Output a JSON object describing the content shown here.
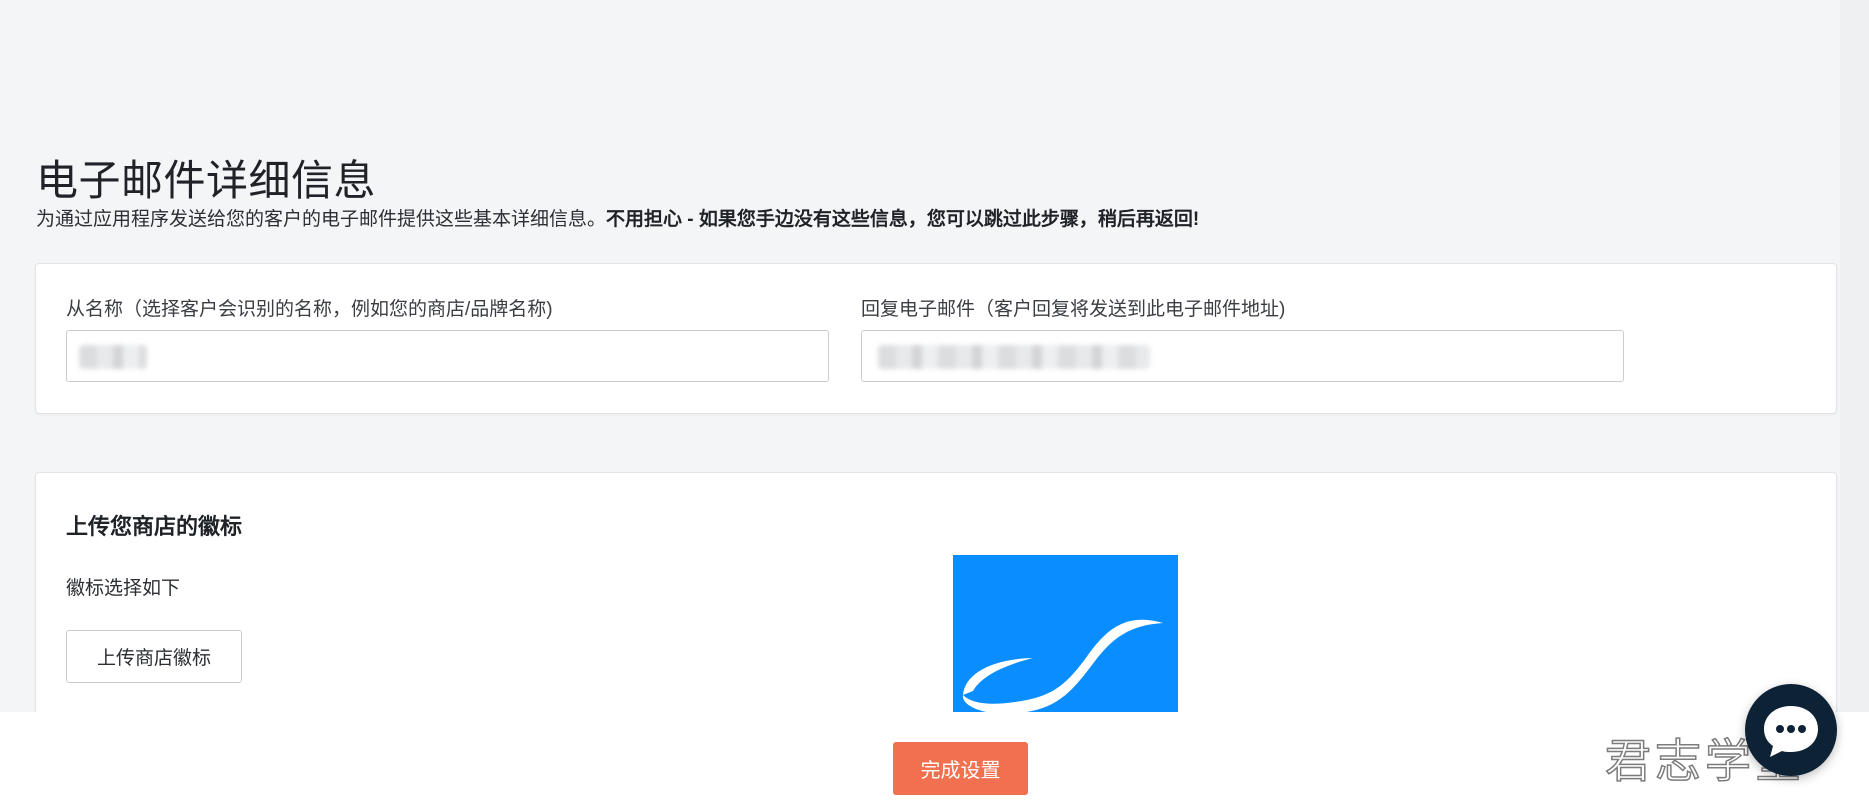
{
  "header": {
    "title": "电子邮件详细信息",
    "subtitle_normal": "为通过应用程序发送给您的客户的电子邮件提供这些基本详细信息。",
    "subtitle_bold": "不用担心 - 如果您手边没有这些信息，您可以跳过此步骤，稍后再返回!"
  },
  "email_card": {
    "from_name_label": "从名称（选择客户会识别的名称，例如您的商店/品牌名称)",
    "reply_email_label": "回复电子邮件（客户回复将发送到此电子邮件地址)"
  },
  "logo_card": {
    "heading": "上传您商店的徽标",
    "subheading": "徽标选择如下",
    "upload_button": "上传商店徽标"
  },
  "footer": {
    "finish_button": "完成设置"
  },
  "watermark": {
    "text": "君志学堂"
  },
  "colors": {
    "primary_button": "#f0704f",
    "logo_background": "#0a8eff",
    "chat_button": "#0e2236",
    "page_background": "#f4f5f7"
  },
  "icons": {
    "chat": "chat-bubble-icon",
    "logo": "store-logo-swoosh"
  }
}
